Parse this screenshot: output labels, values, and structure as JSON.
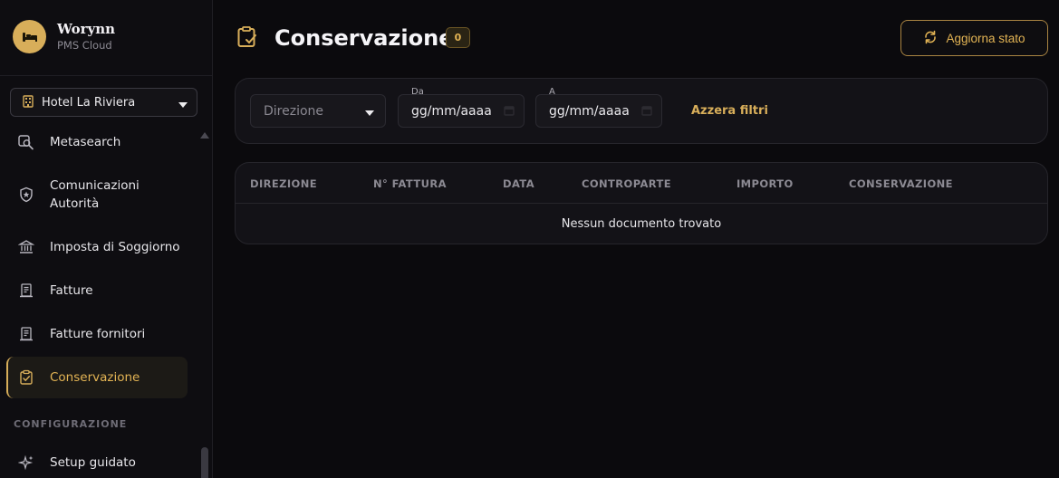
{
  "brand": {
    "name": "Worynn",
    "subtitle": "PMS Cloud"
  },
  "hotel_selector": {
    "value": "Hotel La Riviera"
  },
  "sidebar": {
    "items": [
      {
        "label": "Metasearch",
        "icon": "search-icon"
      },
      {
        "label": "Comunicazioni\nAutorità",
        "icon": "shield-icon"
      },
      {
        "label": "Imposta di Soggiorno",
        "icon": "bank-icon"
      },
      {
        "label": "Fatture",
        "icon": "invoice-icon"
      },
      {
        "label": "Fatture fornitori",
        "icon": "invoice-icon"
      },
      {
        "label": "Conservazione",
        "icon": "clipboard-check-icon",
        "active": true
      }
    ],
    "section_config": "CONFIGURAZIONE",
    "config_items": [
      {
        "label": "Setup guidato",
        "icon": "sparkle-icon"
      }
    ]
  },
  "header": {
    "title": "Conservazione",
    "count": "0",
    "refresh_label": "Aggiorna stato"
  },
  "filters": {
    "direction_placeholder": "Direzione",
    "from_label": "Da",
    "from_value": "gg/mm/aaaa",
    "to_label": "A",
    "to_value": "gg/mm/aaaa",
    "reset_label": "Azzera filtri"
  },
  "table": {
    "columns": [
      "DIREZIONE",
      "N° FATTURA",
      "DATA",
      "CONTROPARTE",
      "IMPORTO",
      "CONSERVAZIONE"
    ],
    "empty_message": "Nessun documento trovato"
  },
  "colors": {
    "accent": "#d8ae5a",
    "background": "#0b0a0d",
    "panel": "#131217"
  }
}
